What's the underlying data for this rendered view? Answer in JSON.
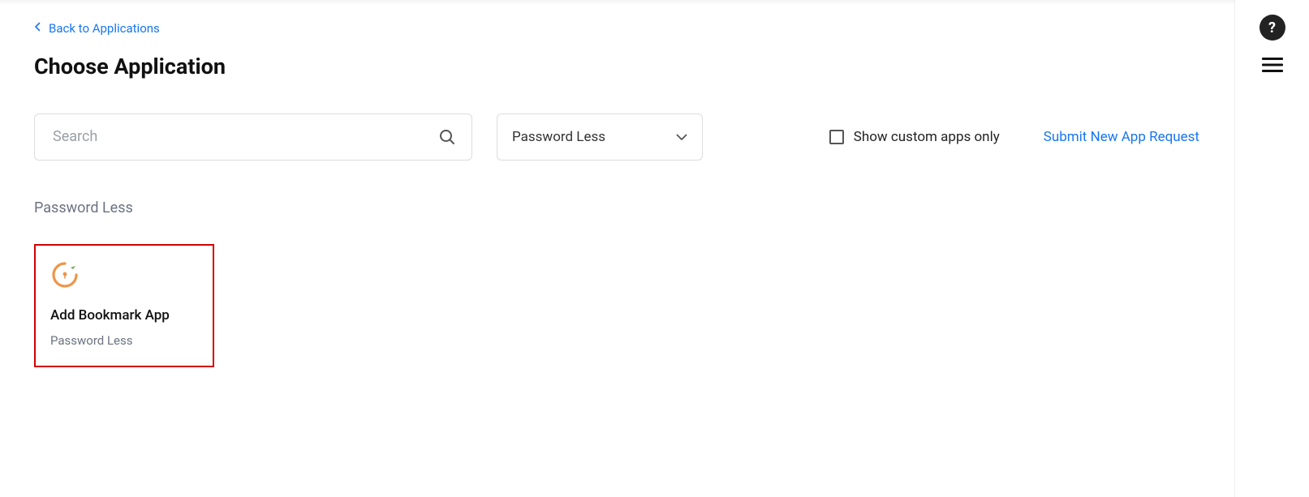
{
  "nav": {
    "back_label": "Back to Applications"
  },
  "page": {
    "title": "Choose Application"
  },
  "search": {
    "placeholder": "Search"
  },
  "filter": {
    "selected": "Password Less"
  },
  "options": {
    "custom_apps_label": "Show custom apps only",
    "submit_request_label": "Submit New App Request"
  },
  "section": {
    "label": "Password Less"
  },
  "apps": [
    {
      "title": "Add Bookmark App",
      "subtitle": "Password Less"
    }
  ]
}
